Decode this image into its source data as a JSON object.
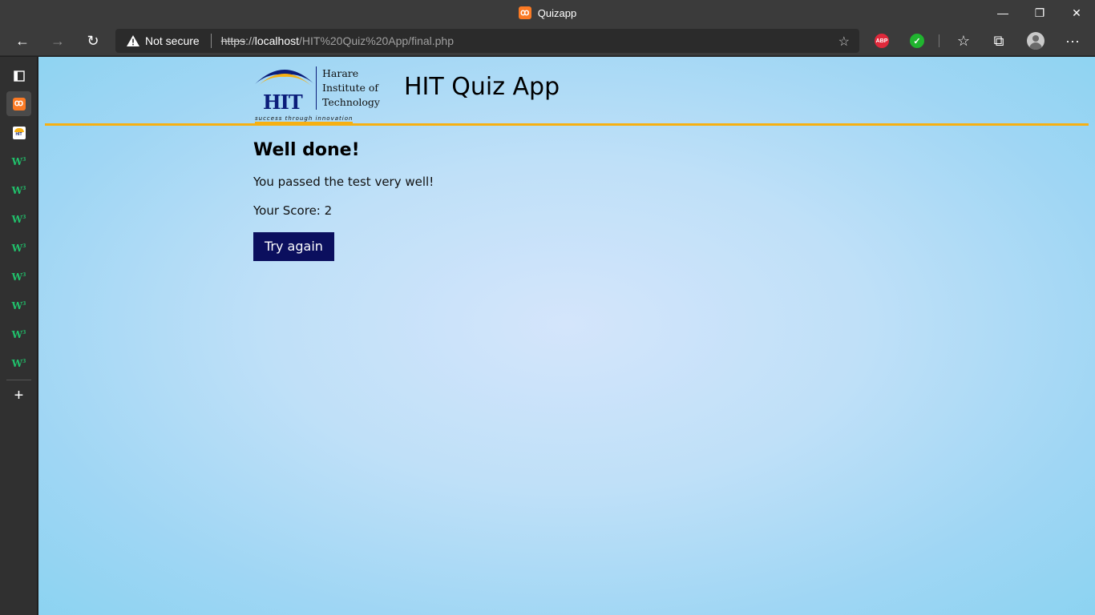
{
  "window": {
    "title": "Quizapp",
    "icon": "xampp-icon",
    "controls": {
      "minimize": "—",
      "restore": "❐",
      "close": "✕"
    }
  },
  "toolbar": {
    "back_icon": "←",
    "forward_icon": "→",
    "refresh_icon": "↻",
    "security_label": "Not secure",
    "url": {
      "protocol": "https",
      "separator": "://",
      "host": "localhost",
      "path": "/HIT%20Quiz%20App/final.php"
    },
    "add_favorite_icon": "☆",
    "extensions": [
      {
        "name": "adblock-plus",
        "label": "ABP",
        "color": "#e0293b"
      },
      {
        "name": "check-extension",
        "label": "✓",
        "color": "#20b52f"
      }
    ],
    "favorites_icon": "☆",
    "collections_icon": "⧉",
    "more_icon": "···"
  },
  "sidebar": {
    "items": [
      {
        "name": "tab-actions",
        "icon": "▢"
      },
      {
        "name": "quizapp-tab",
        "icon": "xampp-icon",
        "active": true
      },
      {
        "name": "hit-tab",
        "icon": "hit-icon"
      },
      {
        "name": "w-tab-1",
        "icon": "w-icon"
      },
      {
        "name": "w-tab-2",
        "icon": "w-icon"
      },
      {
        "name": "w-tab-3",
        "icon": "w-icon"
      },
      {
        "name": "w-tab-4",
        "icon": "w-icon"
      },
      {
        "name": "w-tab-5",
        "icon": "w-icon"
      },
      {
        "name": "w-tab-6",
        "icon": "w-icon"
      },
      {
        "name": "w-tab-7",
        "icon": "w-icon"
      },
      {
        "name": "w-tab-8",
        "icon": "w-icon"
      }
    ],
    "new_tab_icon": "+"
  },
  "page": {
    "logo": {
      "abbr": "HIT",
      "name_lines": [
        "Harare",
        "Institute of",
        "Technology"
      ],
      "tagline": "success through innovation"
    },
    "app_title": "HIT Quiz App",
    "heading": "Well done!",
    "message": "You passed the test very well!",
    "score_text": "Your Score: 2",
    "try_again_label": "Try again"
  },
  "colors": {
    "accent": "#f6b012",
    "button": "#0b0f5e",
    "logo_blue": "#0b1d7a"
  }
}
